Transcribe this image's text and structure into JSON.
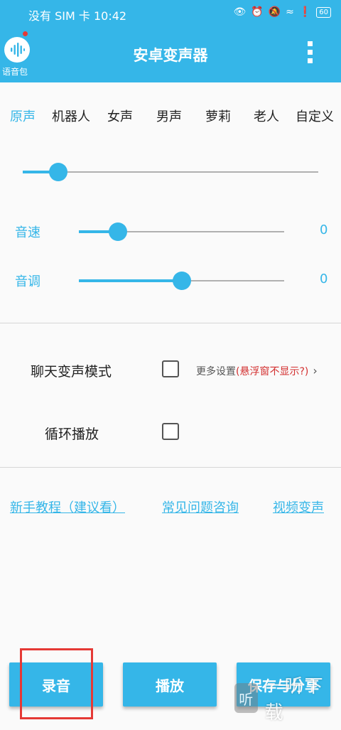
{
  "status_bar": {
    "carrier": "没有 SIM 卡",
    "time": "10:42",
    "battery": "60"
  },
  "app_bar": {
    "title": "安卓变声器",
    "logo_label": "语音包"
  },
  "voice_tabs": [
    {
      "label": "原声",
      "active": true
    },
    {
      "label": "机器人"
    },
    {
      "label": "女声"
    },
    {
      "label": "男声"
    },
    {
      "label": "萝莉"
    },
    {
      "label": "老人"
    },
    {
      "label": "自定义"
    }
  ],
  "preset_slider": {
    "level": 0.12
  },
  "speed": {
    "label": "音速",
    "value": "0",
    "level": 0.19
  },
  "pitch": {
    "label": "音调",
    "value": "0",
    "level": 0.5
  },
  "options": {
    "chat_mode_label": "聊天变声模式",
    "chat_mode_checked": false,
    "more_settings": "更多设置",
    "more_settings_hint": "(悬浮窗不显示?)",
    "loop_label": "循环播放",
    "loop_checked": false
  },
  "links": {
    "tutorial": "新手教程（建议看）",
    "faq": "常见问题咨询",
    "video": "视频变声"
  },
  "buttons": {
    "record": "录音",
    "play": "播放",
    "save_share": "保存与分享"
  },
  "watermark": {
    "logo": "听",
    "text": "一听下载"
  },
  "colors": {
    "accent": "#35b6e8",
    "highlight": "#e53935"
  }
}
